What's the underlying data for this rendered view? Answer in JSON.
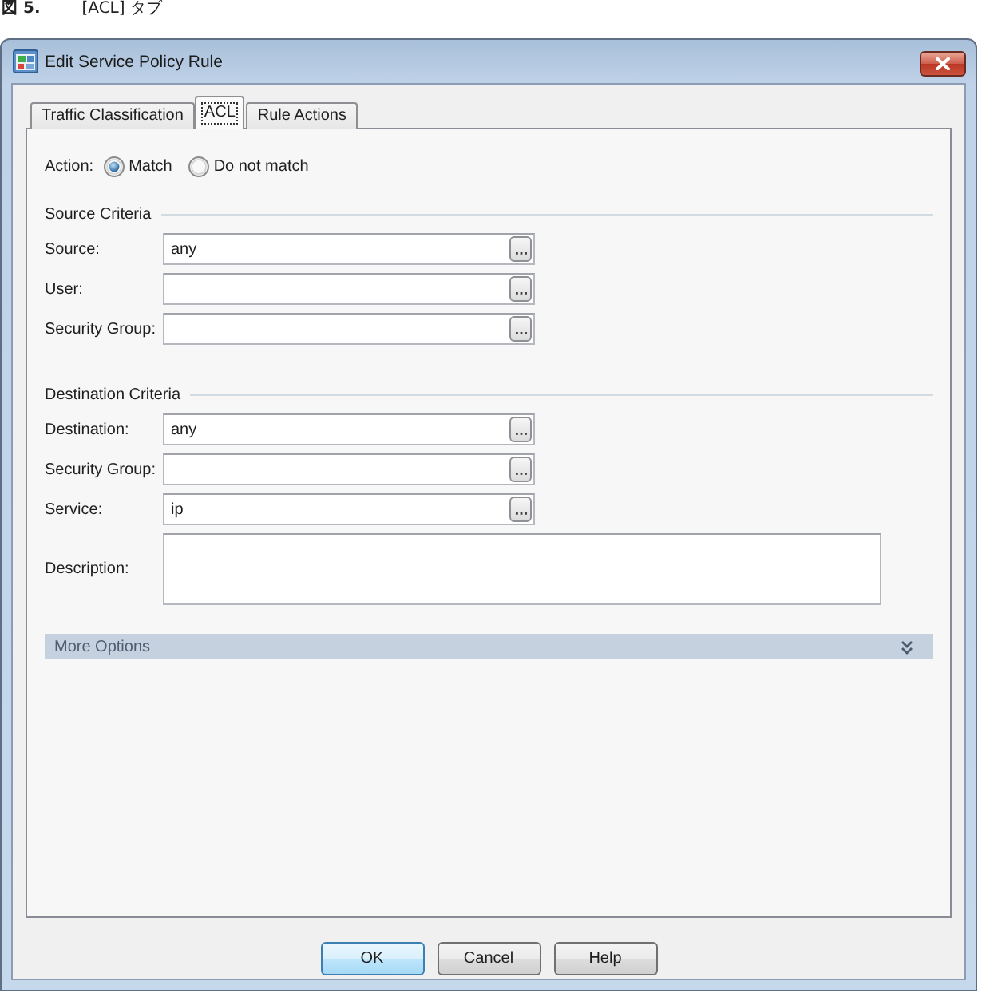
{
  "caption": {
    "number": "図 5.",
    "title": "[ACL] タブ"
  },
  "window": {
    "title": "Edit Service Policy Rule"
  },
  "tabs": [
    {
      "label": "Traffic Classification",
      "selected": false
    },
    {
      "label": "ACL",
      "selected": true
    },
    {
      "label": "Rule Actions",
      "selected": false
    }
  ],
  "action": {
    "label": "Action:",
    "options": [
      {
        "label": "Match",
        "selected": true
      },
      {
        "label": "Do not match",
        "selected": false
      }
    ]
  },
  "sections": [
    {
      "title": "Source Criteria",
      "fields": [
        {
          "kind": "browse",
          "label": "Source:",
          "value": "any"
        },
        {
          "kind": "browse",
          "label": "User:"
        },
        {
          "kind": "browse",
          "label": "Security Group:"
        }
      ]
    },
    {
      "title": "Destination Criteria",
      "fields": [
        {
          "kind": "browse",
          "label": "Destination:",
          "value": "any"
        },
        {
          "kind": "browse",
          "label": "Security Group:"
        },
        {
          "kind": "browse",
          "label": "Service:",
          "value": "ip"
        },
        {
          "kind": "textarea",
          "label": "Description:"
        }
      ]
    }
  ],
  "more_options": {
    "label": "More Options",
    "expanded": false
  },
  "buttons": [
    {
      "label": "OK",
      "default": true
    },
    {
      "label": "Cancel",
      "default": false
    },
    {
      "label": "Help",
      "default": false
    }
  ]
}
